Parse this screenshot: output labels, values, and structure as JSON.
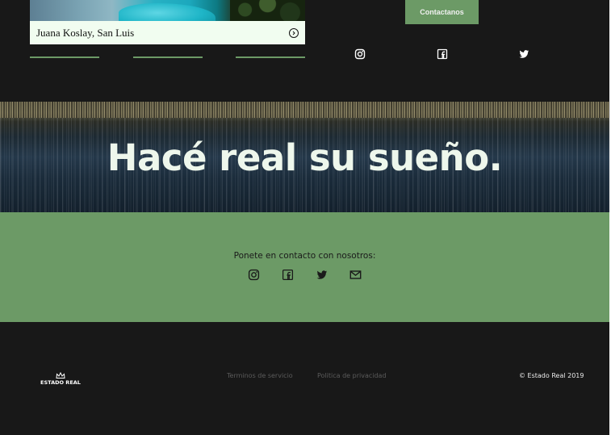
{
  "property_card": {
    "location": "Juana Koslay, San Luis",
    "arrow_icon": "circle-arrow-right-icon"
  },
  "header": {
    "contact_button_label": "Contactanos",
    "social_icons": [
      "instagram-icon",
      "facebook-icon",
      "twitter-icon"
    ]
  },
  "hero": {
    "title": "Hacé real su sueño."
  },
  "contact": {
    "prompt": "Ponete en contacto con nosotros:",
    "social_icons": [
      "instagram-icon",
      "facebook-icon",
      "twitter-icon",
      "mail-icon"
    ]
  },
  "footer": {
    "brand": "ESTADO REAL",
    "logo_icon": "crown-icon",
    "terms_label": "Terminos de servicio",
    "privacy_label": "Politica de privacidad",
    "copyright": "© Estado Real 2019"
  },
  "colors": {
    "accent_green": "#6c9a66",
    "page_background": "#181818",
    "caption_background": "#f1fdf0",
    "hero_text": "#eef7ec"
  }
}
